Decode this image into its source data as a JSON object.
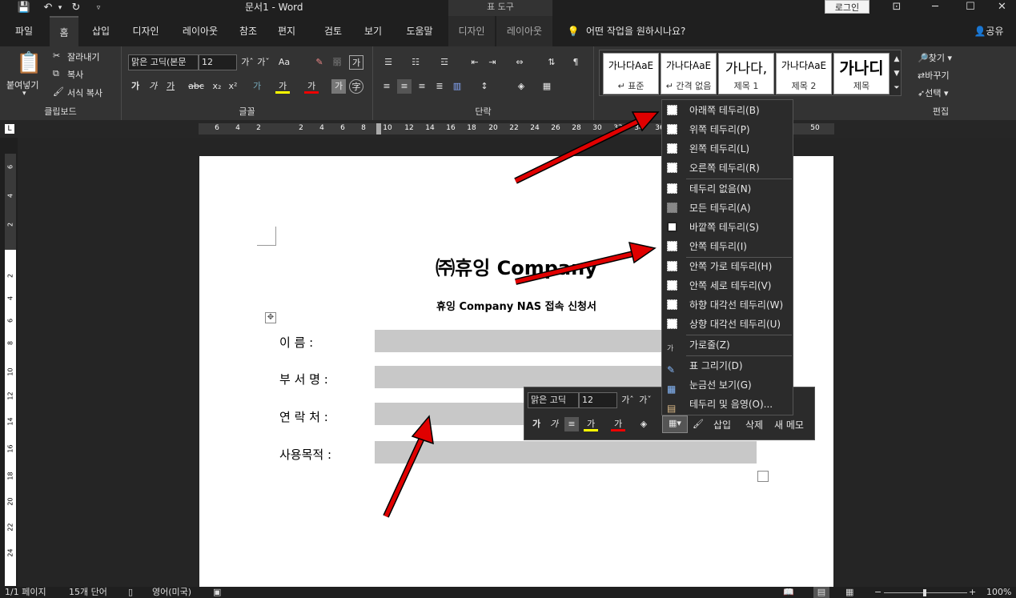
{
  "titlebar": {
    "title": "문서1  -  Word",
    "tool_tab": "표 도구",
    "login_label": "로그인",
    "save_icon": "save-icon",
    "undo_icon": "undo-icon",
    "redo_icon": "redo-icon"
  },
  "tabs": [
    {
      "label": "파일"
    },
    {
      "label": "홈"
    },
    {
      "label": "삽입"
    },
    {
      "label": "디자인"
    },
    {
      "label": "레이아웃"
    },
    {
      "label": "참조"
    },
    {
      "label": "편지"
    },
    {
      "label": "검토"
    },
    {
      "label": "보기"
    },
    {
      "label": "도움말"
    },
    {
      "label": "디자인"
    },
    {
      "label": "레이아웃"
    }
  ],
  "tellme": "어떤 작업을 원하시나요?",
  "share": "공유",
  "clipboard": {
    "paste": "붙여넣기",
    "cut": "잘라내기",
    "copy": "복사",
    "format_painter": "서식 복사",
    "label": "클립보드"
  },
  "font": {
    "name": "맑은 고딕(본문",
    "size": "12",
    "label": "글꼴"
  },
  "paragraph": {
    "label": "단락"
  },
  "styles": [
    {
      "preview": "가나다AaE",
      "name": "↵ 표준"
    },
    {
      "preview": "가나다AaE",
      "name": "↵ 간격 없음"
    },
    {
      "preview": "가나다,",
      "name": "제목 1"
    },
    {
      "preview": "가나다AaE",
      "name": "제목 2"
    },
    {
      "preview": "가나디",
      "name": "제목"
    }
  ],
  "editing": {
    "find": "찾기",
    "replace": "바꾸기",
    "select": "선택",
    "label": "편집"
  },
  "document": {
    "title": "㈜휴잉 Company",
    "subtitle": "휴잉 Company NAS 접속 신청서",
    "fields": [
      {
        "label": "이    름 :"
      },
      {
        "label": "부 서 명 :"
      },
      {
        "label": "연 락 처 :"
      },
      {
        "label": "사용목적 :"
      }
    ]
  },
  "mini_toolbar": {
    "font": "맑은 고딕",
    "size": "12",
    "insert": "삽입",
    "delete": "삭제",
    "new_memo": "새 메모"
  },
  "border_menu": {
    "items": [
      {
        "label": "아래쪽 테두리(B)"
      },
      {
        "label": "위쪽 테두리(P)"
      },
      {
        "label": "왼쪽 테두리(L)"
      },
      {
        "label": "오른쪽 테두리(R)"
      },
      {
        "label": "테두리 없음(N)"
      },
      {
        "label": "모든 테두리(A)"
      },
      {
        "label": "바깥쪽 테두리(S)"
      },
      {
        "label": "안쪽 테두리(I)"
      },
      {
        "label": "안쪽 가로 테두리(H)"
      },
      {
        "label": "안쪽 세로 테두리(V)"
      },
      {
        "label": "하향 대각선 테두리(W)"
      },
      {
        "label": "상향 대각선 테두리(U)"
      },
      {
        "label": "가로줄(Z)"
      },
      {
        "label": "표 그리기(D)"
      },
      {
        "label": "눈금선 보기(G)"
      },
      {
        "label": "테두리 및 음영(O)..."
      }
    ]
  },
  "ruler": {
    "h": [
      "6",
      "4",
      "2",
      "2",
      "4",
      "6",
      "8",
      "10",
      "12",
      "14",
      "16",
      "18",
      "20",
      "22",
      "24",
      "26",
      "28",
      "30",
      "32",
      "34",
      "36",
      "38",
      "40",
      "42",
      "44",
      "46",
      "48",
      "50"
    ],
    "v": [
      "6",
      "4",
      "2",
      "2",
      "4",
      "6",
      "8",
      "10",
      "12",
      "14",
      "16",
      "18",
      "20",
      "22",
      "24"
    ]
  },
  "statusbar": {
    "page": "1/1 페이지",
    "words": "15개 단어",
    "lang": "영어(미국)",
    "zoom": "100%"
  },
  "colors": {
    "accent": "#e00000"
  }
}
